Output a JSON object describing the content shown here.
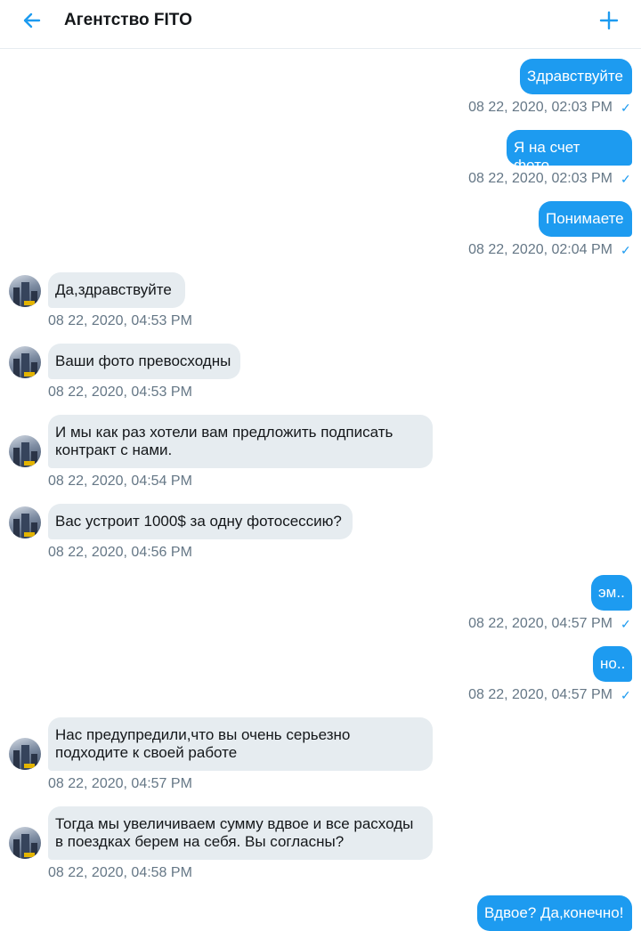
{
  "header": {
    "title": "Агентство FITO",
    "back_icon": "arrow-left-icon",
    "add_icon": "plus-icon"
  },
  "colors": {
    "accent": "#1d9bf0",
    "incoming_bubble": "#e6ecf0",
    "timestamp": "#657786"
  },
  "messages": [
    {
      "dir": "out",
      "text": "Здравствуйте",
      "time": "08 22, 2020, 02:03 PM",
      "read": true
    },
    {
      "dir": "out",
      "text": "Я на счет фото..",
      "time": "08 22, 2020, 02:03 PM",
      "read": true
    },
    {
      "dir": "out",
      "text": "Понимаете",
      "time": "08 22, 2020, 02:04 PM",
      "read": true
    },
    {
      "dir": "in",
      "text": "Да,здравствуйте",
      "time": "08 22, 2020, 04:53 PM"
    },
    {
      "dir": "in",
      "text": "Ваши фото превосходны",
      "time": "08 22, 2020, 04:53 PM"
    },
    {
      "dir": "in",
      "text": "И мы как раз хотели вам предложить подписать контракт с нами.",
      "time": "08 22, 2020, 04:54 PM"
    },
    {
      "dir": "in",
      "text": "Вас устроит 1000$ за одну фотосессию?",
      "time": "08 22, 2020, 04:56 PM"
    },
    {
      "dir": "out",
      "text": "эм..",
      "time": "08 22, 2020, 04:57 PM",
      "read": true
    },
    {
      "dir": "out",
      "text": "но..",
      "time": "08 22, 2020, 04:57 PM",
      "read": true
    },
    {
      "dir": "in",
      "text": "Нас предупредили,что вы очень серьезно подходите к своей работе",
      "time": "08 22, 2020, 04:57 PM"
    },
    {
      "dir": "in",
      "text": "Тогда мы увеличиваем сумму вдвое и все расходы в поездках берем на себя. Вы согласны?",
      "time": "08 22, 2020, 04:58 PM"
    },
    {
      "dir": "out",
      "text": "Вдвое? Да,конечно!",
      "time": ""
    }
  ]
}
